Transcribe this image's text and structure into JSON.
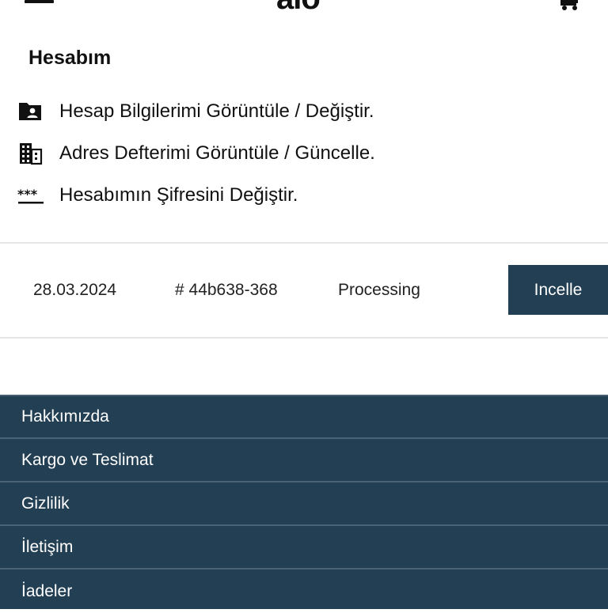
{
  "header": {
    "logo_text": "alo",
    "menu_icon": "hamburger-icon",
    "cart_icon": "cart-icon"
  },
  "account": {
    "title": "Hesabım",
    "items": [
      {
        "icon": "folder-user-icon",
        "label": "Hesap Bilgilerimi Görüntüle / Değiştir."
      },
      {
        "icon": "building-icon",
        "label": "Adres Defterimi Görüntüle / Güncelle."
      },
      {
        "icon": "password-icon",
        "label": "Hesabımın Şifresini Değiştir."
      }
    ]
  },
  "orders": [
    {
      "date": "28.03.2024",
      "id": "# 44b638-368",
      "status": "Processing",
      "action_label": "Incelle"
    }
  ],
  "footer": {
    "links": [
      "Hakkımızda",
      "Kargo ve Teslimat",
      "Gizlilik",
      "İletişim",
      "İadeler"
    ]
  },
  "colors": {
    "primary": "#233f54",
    "divider": "#e6e6e6",
    "text": "#111111"
  }
}
